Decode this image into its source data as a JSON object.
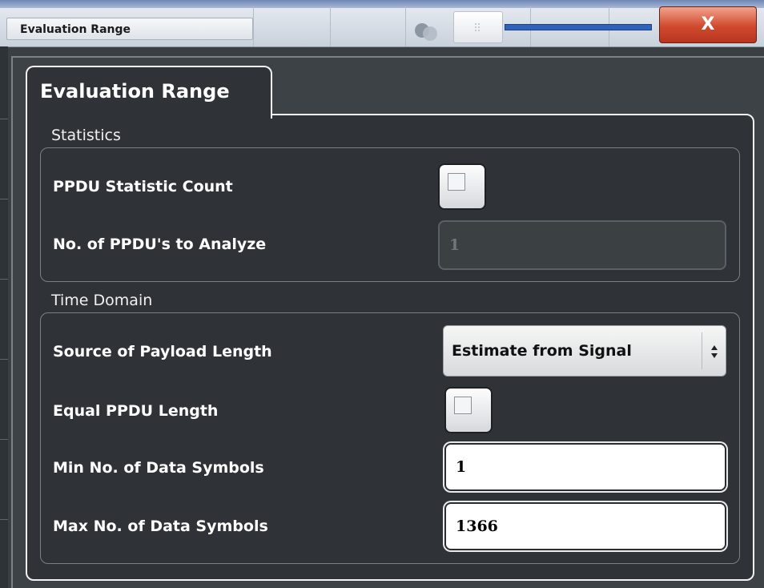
{
  "window": {
    "title": "Evaluation Range",
    "close_label": "X"
  },
  "tab": {
    "label": "Evaluation Range"
  },
  "statistics": {
    "section_title": "Statistics",
    "ppdu_statistic_count": {
      "label": "PPDU Statistic Count",
      "checked": false
    },
    "ppdus_to_analyze": {
      "label": "No. of PPDU's to Analyze",
      "value": "1",
      "enabled": false
    }
  },
  "time_domain": {
    "section_title": "Time Domain",
    "source_of_payload_length": {
      "label": "Source of Payload Length",
      "selected": "Estimate from Signal"
    },
    "equal_ppdu_length": {
      "label": "Equal PPDU Length",
      "checked": false
    },
    "min_data_symbols": {
      "label": "Min No. of Data Symbols",
      "value": "1"
    },
    "max_data_symbols": {
      "label": "Max No. of Data Symbols",
      "value": "1366"
    }
  },
  "colors": {
    "background": "#2f3337",
    "close_button": "#d0492d",
    "slider_track": "#2f62b8"
  }
}
